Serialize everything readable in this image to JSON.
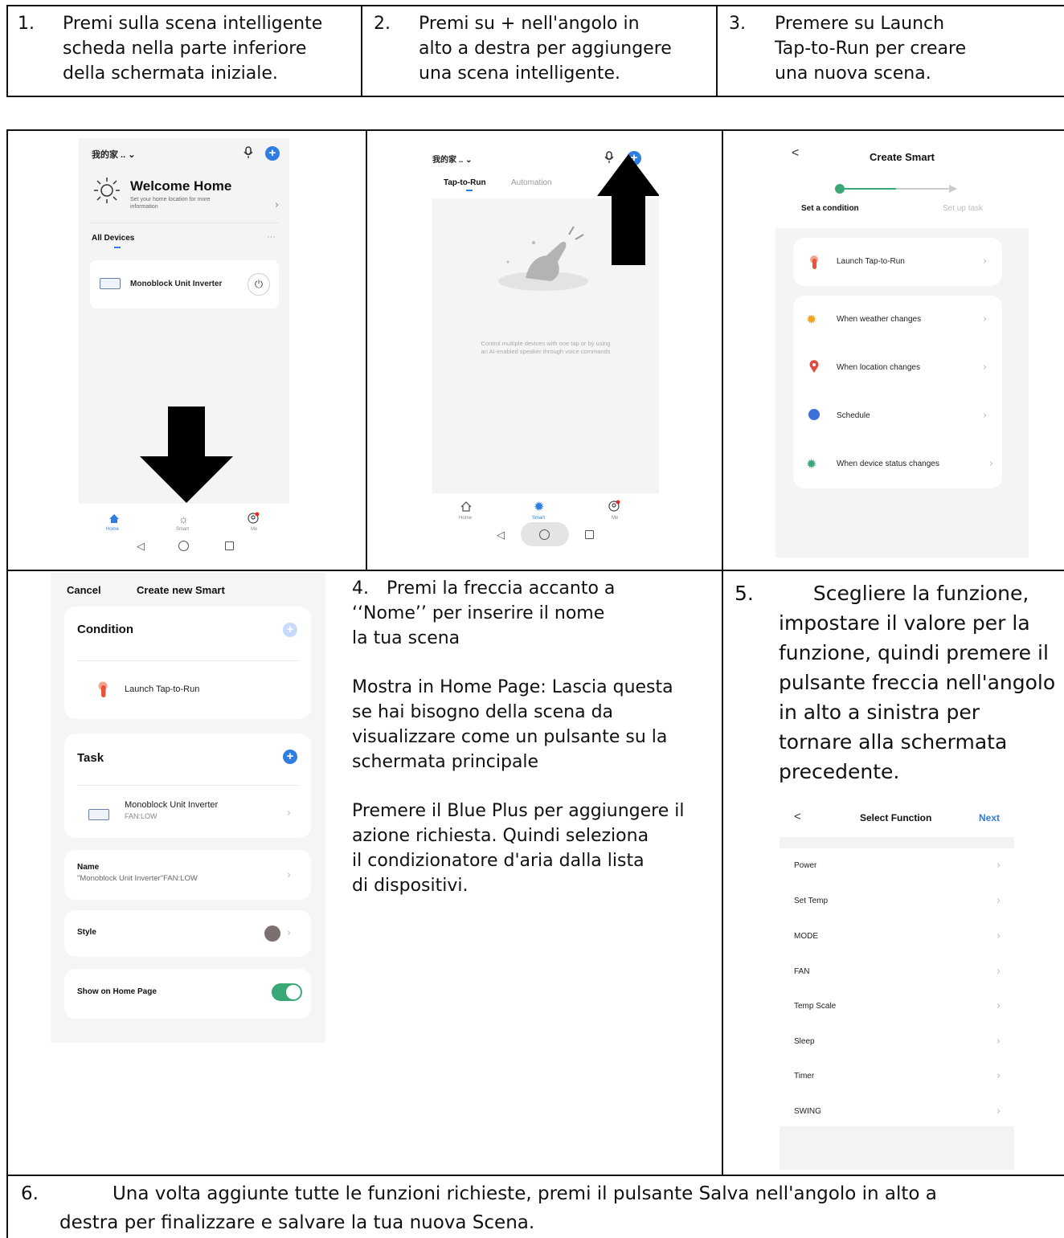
{
  "steps_top": [
    {
      "num": "1.",
      "lines": [
        "Premi sulla scena intelligente",
        "scheda nella parte inferiore",
        "della schermata iniziale."
      ]
    },
    {
      "num": "2.",
      "lines": [
        "Premi su + nell'angolo in",
        "alto a destra per aggiungere",
        "una scena intelligente."
      ]
    },
    {
      "num": "3.",
      "lines": [
        "Premere su Launch",
        "Tap-to-Run per creare",
        "una nuova scena."
      ]
    }
  ],
  "screen1": {
    "home_name": "我的家 .. ⌄",
    "welcome_title": "Welcome Home",
    "welcome_sub_1": "Set your home location for more",
    "welcome_sub_2": "information",
    "section": "All Devices",
    "more": "···",
    "device": "Monoblock Unit Inverter",
    "nav": [
      "Home",
      "Smart",
      "Me"
    ]
  },
  "screen2": {
    "home_name": "我的家 .. ⌄",
    "tab_active": "Tap-to-Run",
    "tab_other": "Automation",
    "empty_1": "Control multiple devices with one tap or by using",
    "empty_2": "an AI-enabled speaker through voice commands",
    "nav": [
      "Home",
      "Smart",
      "Me"
    ]
  },
  "screen3": {
    "back": "<",
    "title": "Create Smart",
    "progress_left": "Set a condition",
    "progress_right": "Set up task",
    "item_launch": "Launch Tap-to-Run",
    "items": [
      "When weather changes",
      "When location changes",
      "Schedule",
      "When device status changes"
    ]
  },
  "screen4": {
    "cancel": "Cancel",
    "title": "Create new Smart",
    "condition": "Condition",
    "launch": "Launch Tap-to-Run",
    "task": "Task",
    "task_device": "Monoblock Unit Inverter",
    "task_value": "FAN:LOW",
    "name_label": "Name",
    "name_value": "\"Monoblock Unit Inverter\"FAN:LOW",
    "style": "Style",
    "show_home": "Show on Home Page"
  },
  "step4": {
    "num": "4.",
    "line1": "Premi  la freccia accanto a",
    "line2": "‘‘Nome’’ per inserire il nome",
    "line3": "la tua scena",
    "para2": [
      "Mostra in Home Page: Lascia questa",
      "se hai bisogno della scena da",
      "visualizzare come un pulsante su la",
      "schermata principale"
    ],
    "para3": [
      "Premere il Blue Plus per aggiungere il",
      "azione richiesta. Quindi seleziona",
      "il condizionatore d'aria dalla lista",
      "di dispositivi."
    ]
  },
  "step5": {
    "num": "5.",
    "line1": "Scegliere la funzione,",
    "lines": [
      "impostare il valore per la",
      "funzione, quindi premere il",
      "pulsante freccia nell'angolo",
      "in alto a sinistra per",
      "tornare alla schermata",
      "precedente."
    ]
  },
  "screen5": {
    "back": "<",
    "title": "Select Function",
    "next": "Next",
    "functions": [
      "Power",
      "Set Temp",
      "MODE",
      "FAN",
      "Temp Scale",
      "Sleep",
      "Timer",
      "SWING"
    ]
  },
  "step6": {
    "num": "6.",
    "line1": "Una volta aggiunte tutte le funzioni richieste, premi il pulsante Salva nell'angolo in alto a",
    "line2": "destra per finalizzare e salvare la tua nuova Scena."
  },
  "colors": {
    "blue": "#2f7de1",
    "green": "#3aa776",
    "border": "#111111"
  }
}
